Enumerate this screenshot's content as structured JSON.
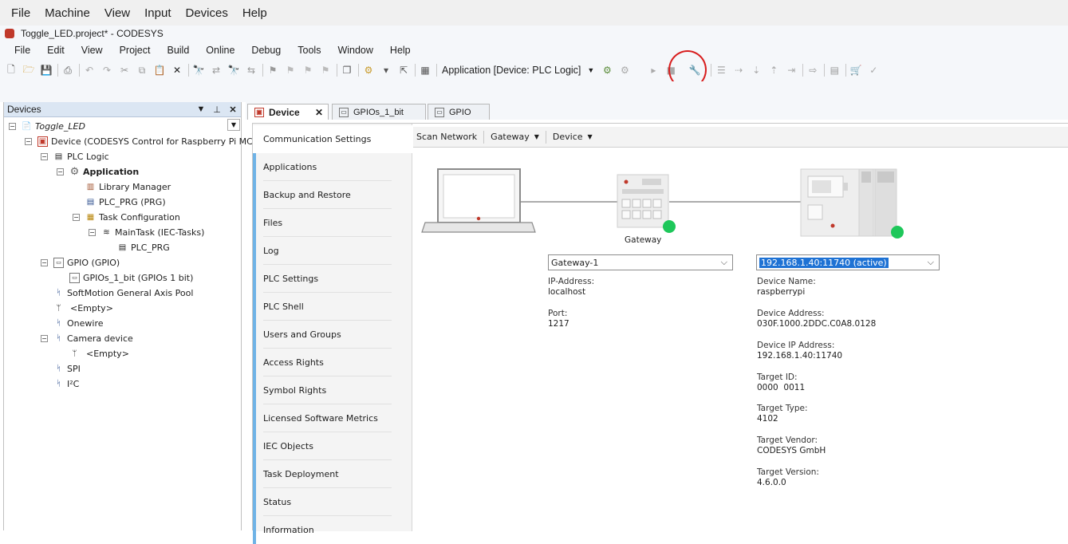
{
  "vb_menu": [
    "File",
    "Machine",
    "View",
    "Input",
    "Devices",
    "Help"
  ],
  "window_title": "Toggle_LED.project* - CODESYS",
  "app_menu": [
    "File",
    "Edit",
    "View",
    "Project",
    "Build",
    "Online",
    "Debug",
    "Tools",
    "Window",
    "Help"
  ],
  "toolbar": {
    "active_application": "Application [Device: PLC Logic]"
  },
  "devices_pane": {
    "title": "Devices",
    "tree": [
      {
        "label": "Toggle_LED",
        "icon": "project-icon"
      },
      {
        "label": "Device (CODESYS Control for Raspberry Pi MC SL",
        "icon": "device-icon"
      },
      {
        "label": "PLC Logic",
        "icon": "plc-logic-icon"
      },
      {
        "label": "Application",
        "icon": "application-gear-icon"
      },
      {
        "label": "Library Manager",
        "icon": "library-icon"
      },
      {
        "label": "PLC_PRG (PRG)",
        "icon": "pou-icon"
      },
      {
        "label": "Task Configuration",
        "icon": "task-config-icon"
      },
      {
        "label": "MainTask (IEC-Tasks)",
        "icon": "task-icon"
      },
      {
        "label": "PLC_PRG",
        "icon": "pou-call-icon"
      },
      {
        "label": "GPIO (GPIO)",
        "icon": "gpio-icon"
      },
      {
        "label": "GPIOs_1_bit (GPIOs 1 bit)",
        "icon": "gpio-icon"
      },
      {
        "label": "SoftMotion General Axis Pool",
        "icon": "connector-icon"
      },
      {
        "label": "<Empty>",
        "icon": "empty-slot-icon"
      },
      {
        "label": "Onewire",
        "icon": "connector-icon"
      },
      {
        "label": "Camera device",
        "icon": "connector-icon"
      },
      {
        "label": "<Empty>",
        "icon": "empty-slot-icon"
      },
      {
        "label": "SPI",
        "icon": "connector-icon"
      },
      {
        "label": "I²C",
        "icon": "connector-icon"
      }
    ]
  },
  "tabs": [
    "Device",
    "GPIOs_1_bit",
    "GPIO"
  ],
  "side_nav": [
    "Communication Settings",
    "Applications",
    "Backup and Restore",
    "Files",
    "Log",
    "PLC Settings",
    "PLC Shell",
    "Users and Groups",
    "Access Rights",
    "Symbol Rights",
    "Licensed Software Metrics",
    "IEC Objects",
    "Task Deployment",
    "Status",
    "Information"
  ],
  "sub_toolbar": [
    "Scan Network",
    "Gateway",
    "Device"
  ],
  "gateway": {
    "caption": "Gateway",
    "selected": "Gateway-1",
    "ip_label": "IP-Address:",
    "ip_value": "localhost",
    "port_label": "Port:",
    "port_value": "1217"
  },
  "device": {
    "selected": "192.168.1.40:11740 (active)",
    "fields": [
      {
        "label": "Device Name:",
        "value": "raspberrypi"
      },
      {
        "label": "Device Address:",
        "value": "030F.1000.2DDC.C0A8.0128"
      },
      {
        "label": "Device IP Address:",
        "value": "192.168.1.40:11740"
      },
      {
        "label": "Target ID:",
        "value": "0000  0011"
      },
      {
        "label": "Target Type:",
        "value": "4102"
      },
      {
        "label": "Target Vendor:",
        "value": "CODESYS GmbH"
      },
      {
        "label": "Target Version:",
        "value": "4.6.0.0"
      }
    ]
  },
  "colors": {
    "status_ok": "#1ec75a",
    "highlight_circle": "#d81e1e",
    "nav_accent": "#6fb3e6",
    "selection": "#1e72d4"
  }
}
